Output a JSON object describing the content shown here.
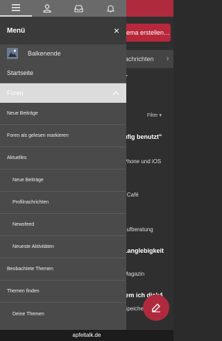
{
  "drawer": {
    "title": "Menü",
    "close_icon": "close-icon",
    "user_name": "Balkenende",
    "items": [
      {
        "label": "Startseite"
      },
      {
        "label": "Foren"
      },
      {
        "label": "Neue Beiträge"
      },
      {
        "label": "Foren als gelesen markieren"
      },
      {
        "label": "Aktuelles"
      },
      {
        "label": "Neue Beiträge"
      },
      {
        "label": "Profilnachrichten"
      },
      {
        "label": "Newsfeed"
      },
      {
        "label": "Neueste Aktivitäten"
      },
      {
        "label": "Beobachtete Themen"
      },
      {
        "label": "Themen finden"
      },
      {
        "label": "Deine Themen"
      }
    ]
  },
  "background": {
    "create_button": "ema erstellen…",
    "nachrichten": "achrichten",
    "filter": "Filter ▾",
    "texts": [
      {
        "text": "ufig benutzt\"",
        "bold": true
      },
      {
        "text": "Phone und iOS",
        "bold": false
      },
      {
        "text": "· Café",
        "bold": false
      },
      {
        "text": "aufberatung",
        "bold": false
      },
      {
        "text": "Langlebigkeit",
        "bold": true
      },
      {
        "text": "Magazin",
        "bold": false
      },
      {
        "text": "lem ich disk4",
        "bold": true
      },
      {
        "text": "Speiche",
        "bold": false
      }
    ],
    "footer": "apfeltalk.de"
  },
  "colors": {
    "accent": "#b02a3e",
    "drawer_bg": "#4a4a4a",
    "drawer_top": "#6a6a6a",
    "header_bg": "#3a3a3a",
    "selected_bg": "#dcdcdc"
  }
}
